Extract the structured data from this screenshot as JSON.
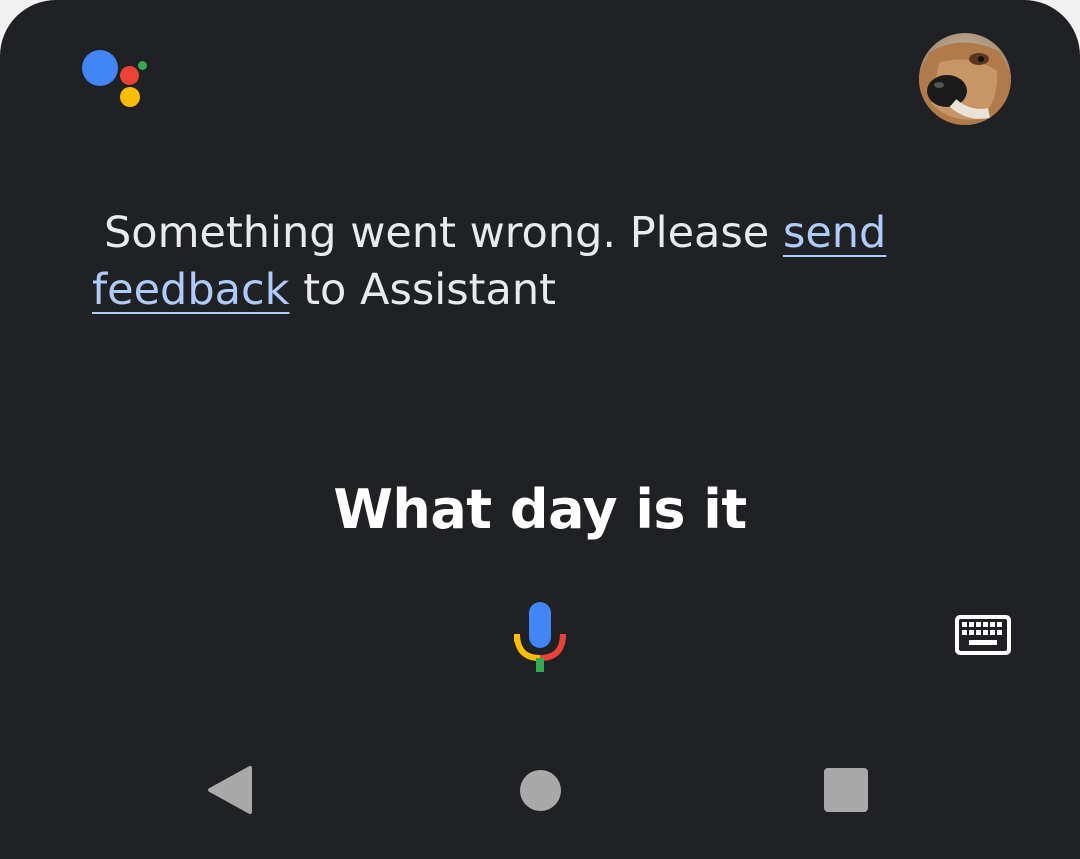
{
  "assistant": {
    "logo_icon": "google-assistant-dots-icon",
    "logo_colors": {
      "blue": "#4285f4",
      "red": "#ea4335",
      "yellow": "#fbbc05",
      "green": "#34a853"
    },
    "avatar_icon": "user-avatar-dog"
  },
  "response": {
    "lead_text": " Something went wrong. Please ",
    "link_text": "send feedback",
    "trailing_text": " to Assistant"
  },
  "query": {
    "text": "What day is it"
  },
  "input": {
    "mic_icon": "microphone-icon",
    "keyboard_icon": "keyboard-icon"
  },
  "navbar": {
    "back_icon": "back-triangle-icon",
    "home_icon": "home-circle-icon",
    "recents_icon": "recents-square-icon"
  }
}
